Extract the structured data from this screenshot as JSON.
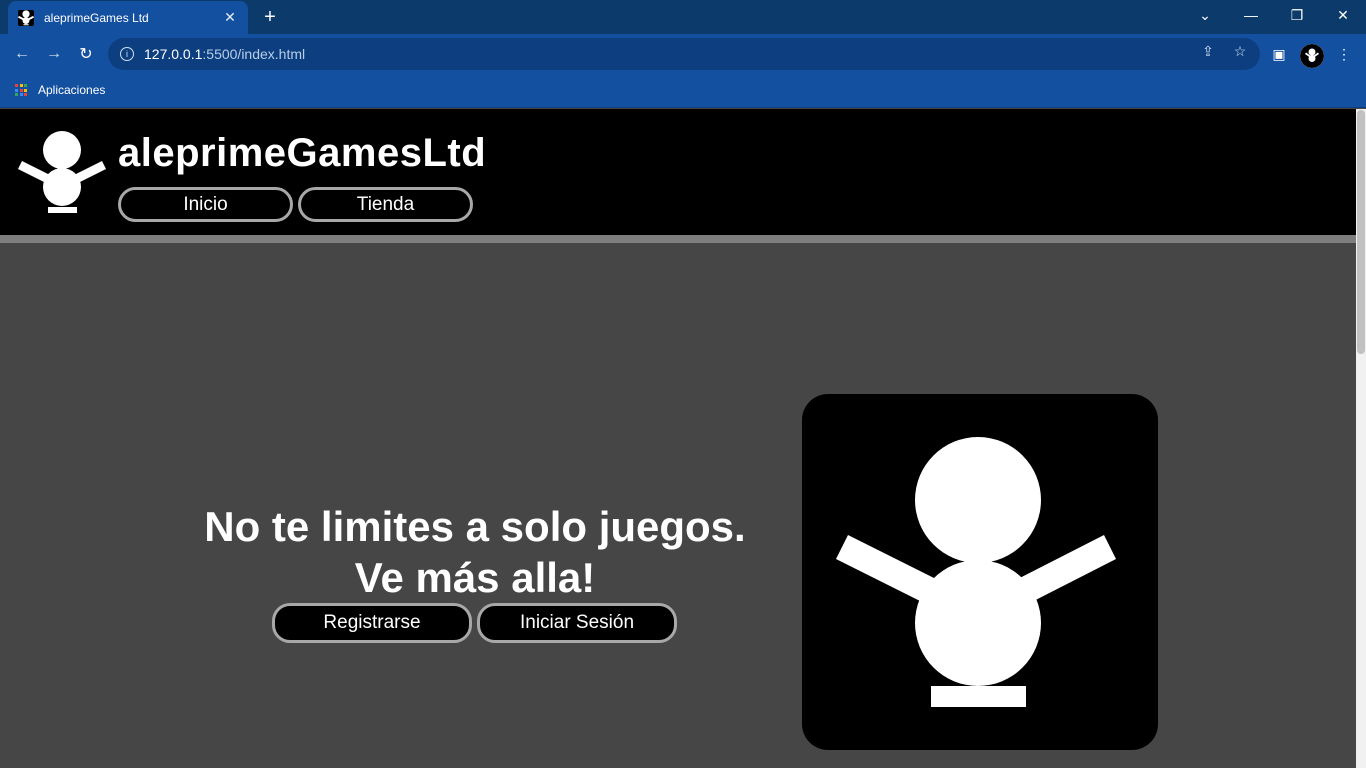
{
  "browser": {
    "tab_title": "aleprimeGames Ltd",
    "url_host": "127.0.0.1",
    "url_path": ":5500/index.html",
    "bookmarks_apps_label": "Aplicaciones"
  },
  "site": {
    "title": "aleprimeGamesLtd",
    "nav": [
      "Inicio",
      "Tienda"
    ]
  },
  "hero": {
    "line1": "No te limites a solo juegos.",
    "line2": "Ve más alla!",
    "register_label": "Registrarse",
    "login_label": "Iniciar Sesión"
  },
  "colors": {
    "chrome_dark": "#0b3a6b",
    "chrome": "#1350a0",
    "page_bg": "#464646",
    "header_bg": "#000000",
    "pill_border": "#a8a8a8"
  }
}
